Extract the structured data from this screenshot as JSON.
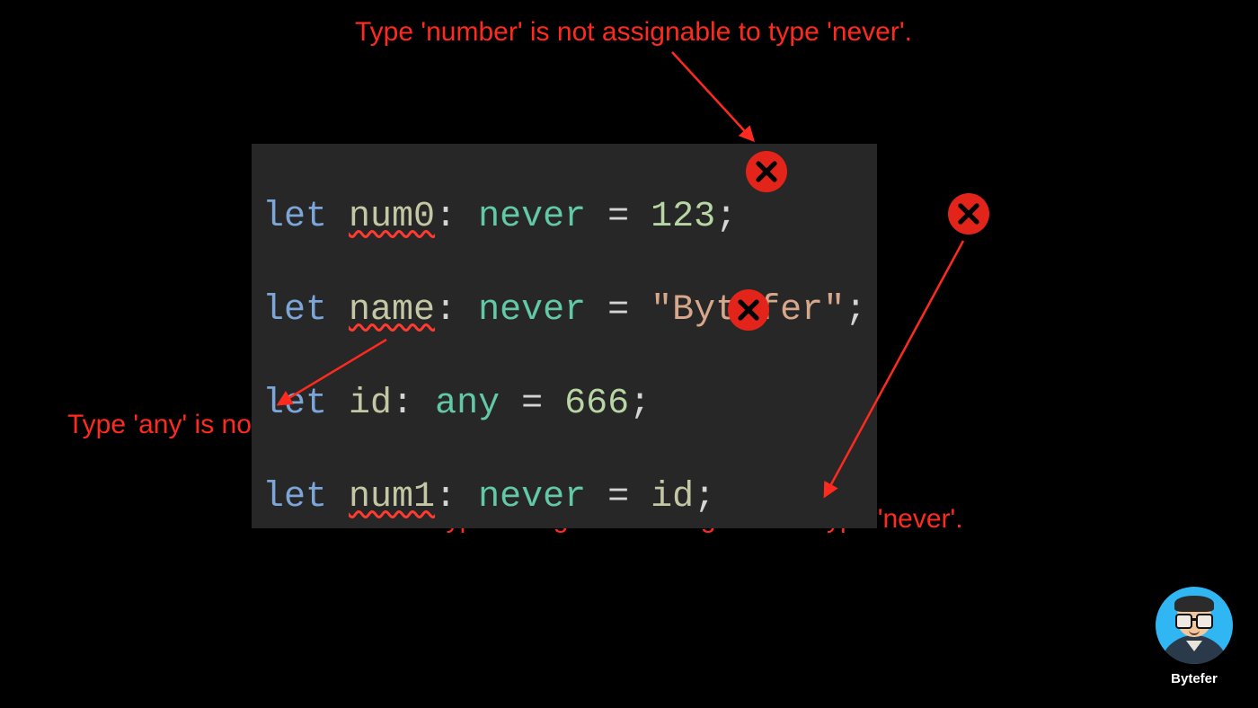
{
  "annotations": {
    "top": "Type 'number' is not assignable to type 'never'.",
    "left": "Type 'any' is not assignable to type 'never'.",
    "bottom": "Type 'string' is not assignable to type 'never'."
  },
  "code": {
    "line1": {
      "keyword": "let",
      "var": "num0",
      "colon": ":",
      "type": "never",
      "eq": "=",
      "value": "123",
      "semi": ";"
    },
    "line2": {
      "keyword": "let",
      "var": "name",
      "colon": ":",
      "type": "never",
      "eq": "=",
      "value": "\"Bytefer\"",
      "semi": ";"
    },
    "line3": {
      "keyword": "let",
      "var": "id",
      "colon": ":",
      "type": "any",
      "eq": "=",
      "value": "666",
      "semi": ";"
    },
    "line4": {
      "keyword": "let",
      "var": "num1",
      "colon": ":",
      "type": "never",
      "eq": "=",
      "value": "id",
      "semi": ";"
    }
  },
  "author": "Bytefer"
}
